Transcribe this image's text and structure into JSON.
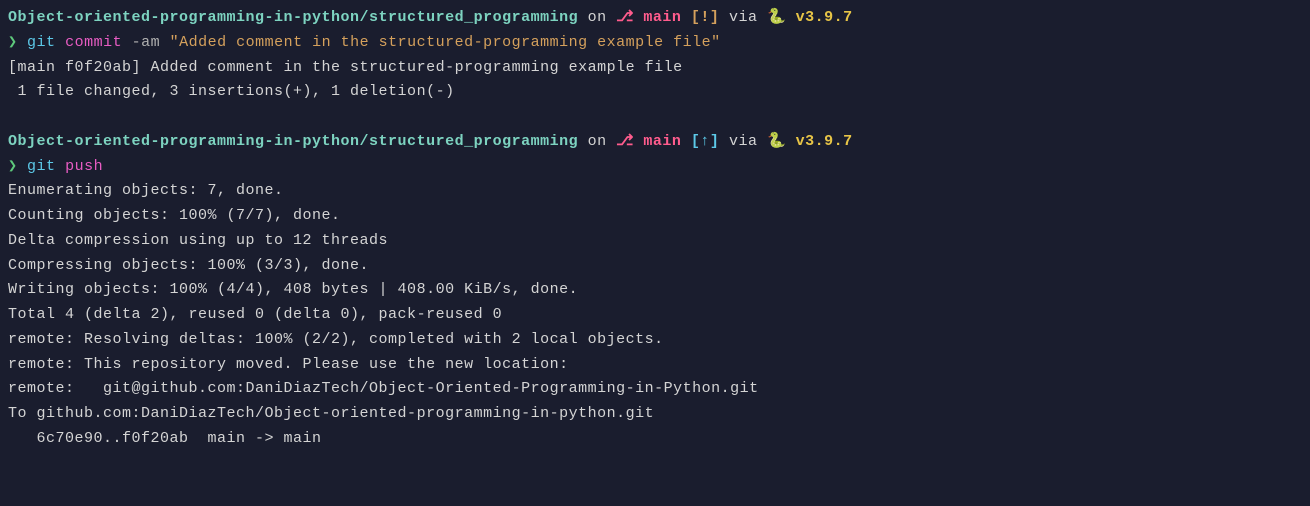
{
  "block1": {
    "prompt": {
      "path": "Object-oriented-programming-in-python/structured_programming",
      "on": " on ",
      "branch_icon": "⎇",
      "branch": " main ",
      "status": "[!]",
      "via": " via ",
      "snake": "🐍 ",
      "version": "v3.9.7"
    },
    "cmd": {
      "arrow": "❯ ",
      "git": "git ",
      "sub": "commit ",
      "flag": "-am ",
      "string": "\"Added comment in the structured-programming example file\""
    },
    "out1": "[main f0f20ab] Added comment in the structured-programming example file",
    "out2": " 1 file changed, 3 insertions(+), 1 deletion(-)"
  },
  "block2": {
    "prompt": {
      "path": "Object-oriented-programming-in-python/structured_programming",
      "on": " on ",
      "branch_icon": "⎇",
      "branch": " main ",
      "status": "[↑]",
      "via": " via ",
      "snake": "🐍 ",
      "version": "v3.9.7"
    },
    "cmd": {
      "arrow": "❯ ",
      "git": "git ",
      "sub": "push"
    },
    "out1": "Enumerating objects: 7, done.",
    "out2": "Counting objects: 100% (7/7), done.",
    "out3": "Delta compression using up to 12 threads",
    "out4": "Compressing objects: 100% (3/3), done.",
    "out5": "Writing objects: 100% (4/4), 408 bytes | 408.00 KiB/s, done.",
    "out6": "Total 4 (delta 2), reused 0 (delta 0), pack-reused 0",
    "out7": "remote: Resolving deltas: 100% (2/2), completed with 2 local objects.",
    "out8": "remote: This repository moved. Please use the new location:",
    "out9": "remote:   git@github.com:DaniDiazTech/Object-Oriented-Programming-in-Python.git",
    "out10": "To github.com:DaniDiazTech/Object-oriented-programming-in-python.git",
    "out11": "   6c70e90..f0f20ab  main -> main"
  }
}
